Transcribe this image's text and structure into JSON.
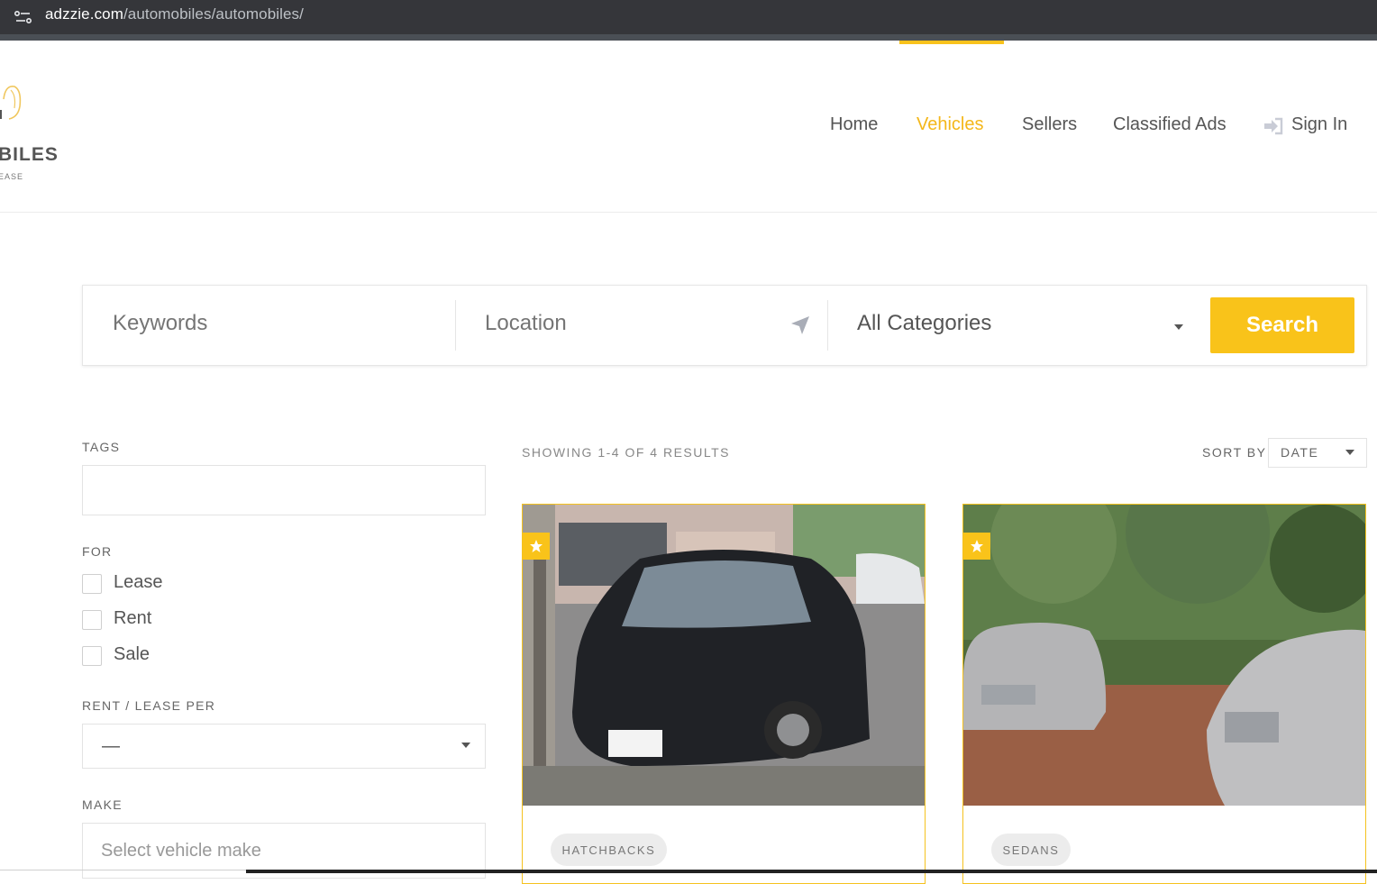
{
  "browser": {
    "url_host": "adzzie.com",
    "url_path": "/automobiles/automobiles/"
  },
  "header": {
    "logo_text": "BILES",
    "logo_sub": "EASE",
    "nav": [
      {
        "label": "Home",
        "active": false
      },
      {
        "label": "Vehicles",
        "active": true
      },
      {
        "label": "Sellers",
        "active": false
      },
      {
        "label": "Classified Ads",
        "active": false
      }
    ],
    "sign_in": "Sign In"
  },
  "search": {
    "keywords_placeholder": "Keywords",
    "location_placeholder": "Location",
    "category_selected": "All Categories",
    "button_label": "Search"
  },
  "filters": {
    "tags_label": "TAGS",
    "for_label": "FOR",
    "for_options": [
      "Lease",
      "Rent",
      "Sale"
    ],
    "rent_lease_per_label": "RENT / LEASE PER",
    "rent_lease_per_value": "—",
    "make_label": "MAKE",
    "make_placeholder": "Select vehicle make"
  },
  "results": {
    "count_text": "SHOWING 1-4 OF 4 RESULTS",
    "sort_by_label": "SORT BY",
    "sort_by_value": "DATE",
    "listings": [
      {
        "category": "HATCHBACKS",
        "featured": true
      },
      {
        "category": "SEDANS",
        "featured": true
      }
    ]
  },
  "colors": {
    "accent": "#f9c31a",
    "browser_bar": "#35363a"
  }
}
